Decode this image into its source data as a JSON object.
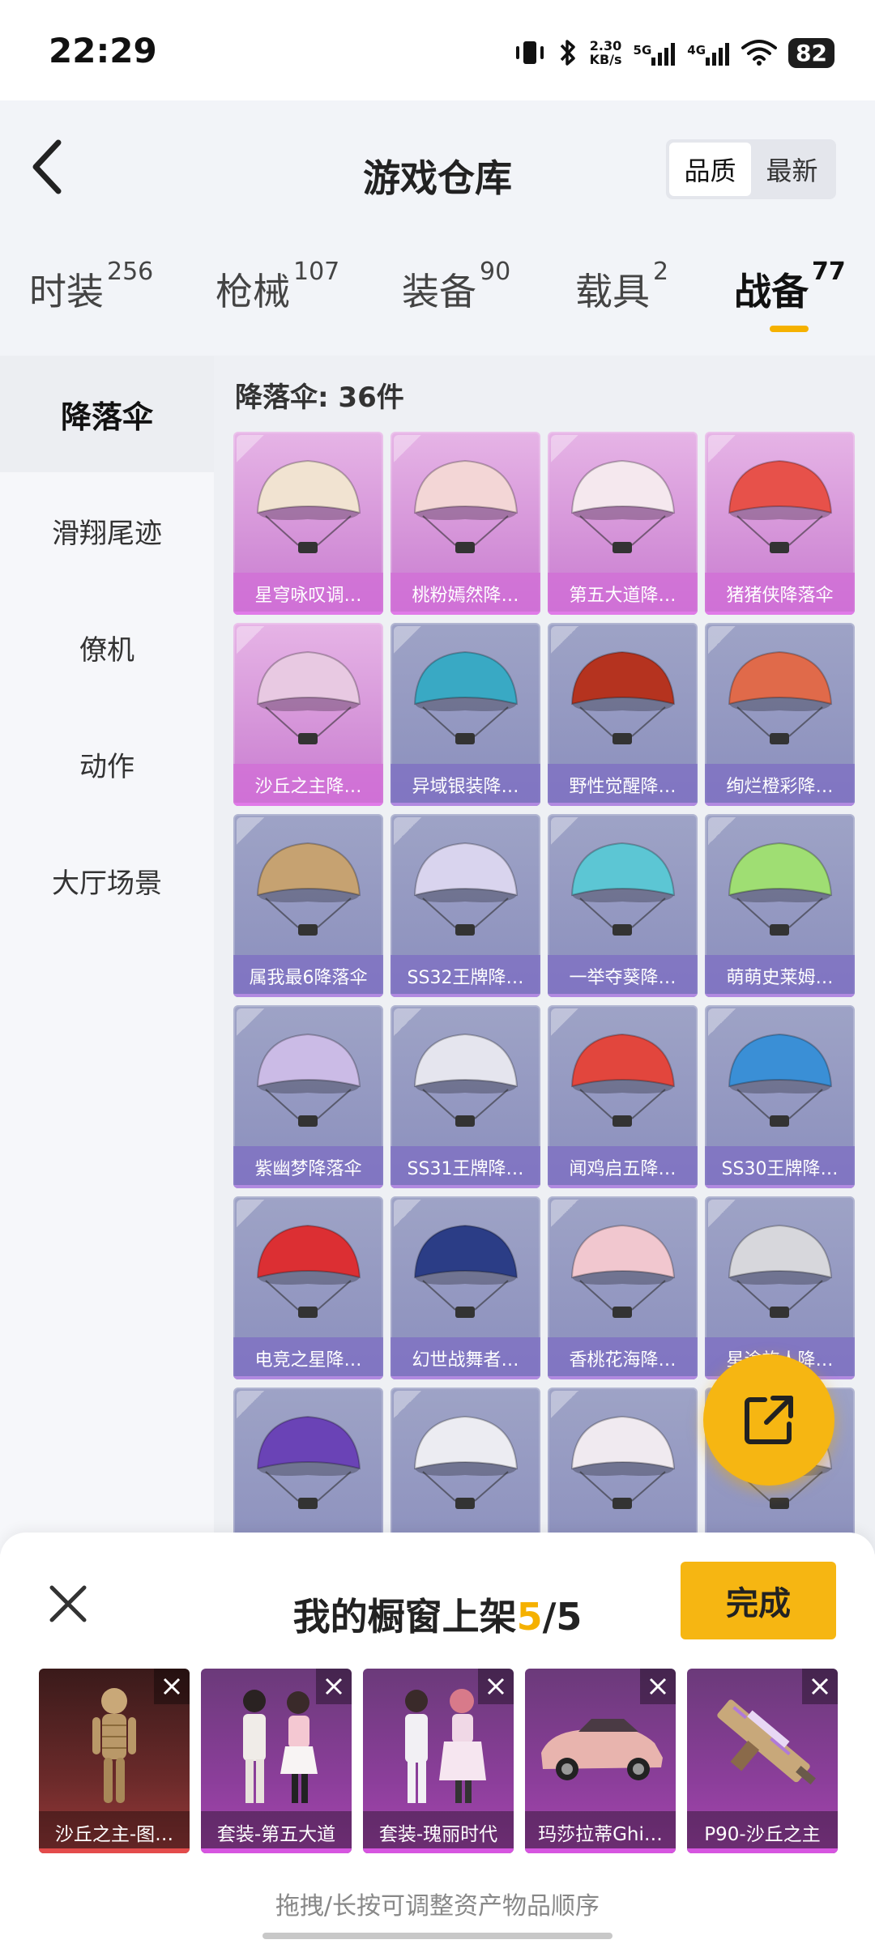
{
  "status_bar": {
    "time": "22:29",
    "net_speed_value": "2.30",
    "net_speed_unit": "KB/s",
    "net_5g": "5G",
    "net_4g": "4G",
    "battery": "82",
    "icons": [
      "vibrate-icon",
      "bluetooth-icon",
      "signal-5g-icon",
      "signal-4g-icon",
      "wifi-icon",
      "battery-icon"
    ]
  },
  "header": {
    "title": "游戏仓库",
    "sort_options": [
      "品质",
      "最新"
    ],
    "active_sort": "品质"
  },
  "tabs": [
    {
      "label": "时装",
      "count": "256"
    },
    {
      "label": "枪械",
      "count": "107"
    },
    {
      "label": "装备",
      "count": "90"
    },
    {
      "label": "载具",
      "count": "2"
    },
    {
      "label": "战备",
      "count": "77"
    }
  ],
  "active_tab": "战备",
  "sidebar": {
    "items": [
      "降落伞",
      "滑翔尾迹",
      "僚机",
      "动作",
      "大厅场景"
    ],
    "active": "降落伞"
  },
  "content": {
    "count_label": "降落伞: 36件",
    "items": [
      {
        "label": "星穹咏叹调…",
        "tier": "purple",
        "color": "#f1e3d1"
      },
      {
        "label": "桃粉嫣然降…",
        "tier": "purple",
        "color": "#f3d6d6"
      },
      {
        "label": "第五大道降…",
        "tier": "purple",
        "color": "#f5e8ee"
      },
      {
        "label": "猪猪侠降落伞",
        "tier": "purple",
        "color": "#e7514a"
      },
      {
        "label": "沙丘之主降…",
        "tier": "purple",
        "color": "#e8c9e2"
      },
      {
        "label": "异域银装降…",
        "tier": "blue",
        "color": "#39a9c4"
      },
      {
        "label": "野性觉醒降…",
        "tier": "blue",
        "color": "#b5331f"
      },
      {
        "label": "绚烂橙彩降…",
        "tier": "blue",
        "color": "#e06a4a"
      },
      {
        "label": "属我最6降落伞",
        "tier": "blue",
        "color": "#c6a271"
      },
      {
        "label": "SS32王牌降…",
        "tier": "blue",
        "color": "#d9d4ee"
      },
      {
        "label": "一举夺葵降…",
        "tier": "blue",
        "color": "#5cc6d4"
      },
      {
        "label": "萌萌史莱姆…",
        "tier": "blue",
        "color": "#9fde73"
      },
      {
        "label": "紫幽梦降落伞",
        "tier": "blue",
        "color": "#cbbbe6"
      },
      {
        "label": "SS31王牌降…",
        "tier": "blue",
        "color": "#e5e5ee"
      },
      {
        "label": "闻鸡启五降…",
        "tier": "blue",
        "color": "#e2463d"
      },
      {
        "label": "SS30王牌降…",
        "tier": "blue",
        "color": "#3a8fd6"
      },
      {
        "label": "电竞之星降…",
        "tier": "blue",
        "color": "#dc2f33"
      },
      {
        "label": "幻世战舞者…",
        "tier": "blue",
        "color": "#2b3d86"
      },
      {
        "label": "香桃花海降…",
        "tier": "blue",
        "color": "#f1c7cf"
      },
      {
        "label": "星途旅人降…",
        "tier": "blue",
        "color": "#d7d7dc"
      },
      {
        "label": "",
        "tier": "blue",
        "color": "#6a43b6"
      },
      {
        "label": "",
        "tier": "blue",
        "color": "#ececf2"
      },
      {
        "label": "",
        "tier": "blue",
        "color": "#f0eaf0"
      },
      {
        "label": "",
        "tier": "blue",
        "color": "#cfc8e2"
      }
    ]
  },
  "share_button": {
    "icon": "share-icon"
  },
  "sheet": {
    "title_prefix": "我的橱窗上架",
    "current": "5",
    "separator": "/",
    "max": "5",
    "done_label": "完成",
    "slots": [
      {
        "label": "沙丘之主-图…",
        "tier": "red"
      },
      {
        "label": "套装-第五大道",
        "tier": "purple"
      },
      {
        "label": "套装-瑰丽时代",
        "tier": "purple"
      },
      {
        "label": "玛莎拉蒂Ghi…",
        "tier": "purple"
      },
      {
        "label": "P90-沙丘之主",
        "tier": "purple"
      }
    ],
    "hint": "拖拽/长按可调整资产物品顺序"
  },
  "colors": {
    "accent": "#f6b612",
    "header_bg": "#f2f4f8",
    "card_blue": "#8b8fbd",
    "card_purple": "#d492d8"
  }
}
